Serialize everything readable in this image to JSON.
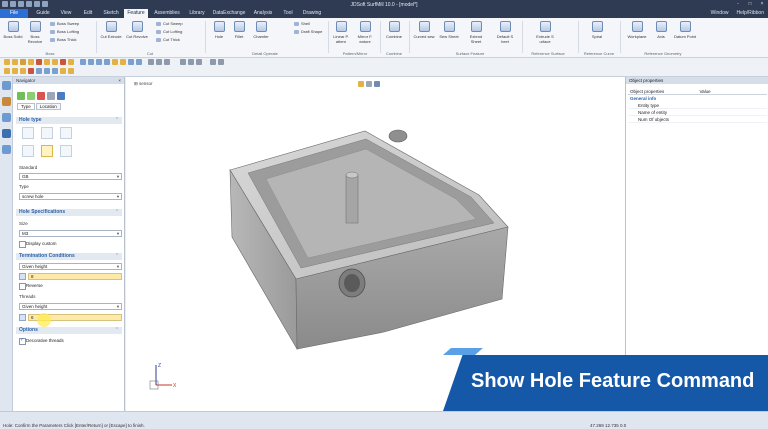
{
  "app": {
    "title": "JDSoft SurfMill 10.0 - [model*]",
    "window_controls": [
      "-",
      "□",
      "×"
    ]
  },
  "tabs": [
    "File",
    "Guide",
    "View",
    "Edit",
    "Sketch",
    "Feature",
    "Assemblies",
    "Library",
    "DataExchange",
    "Analysis",
    "Tool",
    "Drawing"
  ],
  "tabs_right": {
    "window": "Window",
    "help": "Help/Ribbon"
  },
  "ribbon": {
    "boss_solid": "Boss Solid",
    "boss_revolve": "Boss Revolve",
    "boss_sweep": "Boss Sweep",
    "boss_lofting": "Boss Lofting",
    "boss_thick": "Boss Thick",
    "boss_group": "Boss",
    "cut_extrude": "Cut Extrude",
    "cut_revolve": "Cut Revolve",
    "cut_sweep": "Cut Sweep",
    "cut_lofting": "Cut Lofting",
    "cut_thick": "Cut Thick",
    "cut_group": "Cut",
    "hole": "Hole",
    "fillet": "Fillet",
    "chamfer": "Chamfer",
    "shell": "Shell",
    "draft_shape": "Draft Shape",
    "detail_group": "Detail Operate",
    "linear_pattern": "Linear P. attern",
    "mirror_feature": "Mirror F. eature",
    "pattern_group": "Pattern/Mirror",
    "combine": "Combine",
    "combine_group": "Combine",
    "curved_sew": "Curved sew",
    "sew_sheet": "Sew Sheet",
    "extend_sheet": "Extend Sheet",
    "default_sheet": "Default S heet",
    "surface_group": "Surface Feature",
    "extrude_surface": "Extrude S urface",
    "refsurf_group": "Reference Surface",
    "spiral": "Spiral",
    "refcurve_group": "Reference Curve",
    "workplane": "Workplane",
    "axis": "Axis",
    "datum_point": "Datum Point",
    "refgeo_group": "Reference Geometry"
  },
  "navigator": {
    "title": "Navigator",
    "tabs": [
      "Type",
      "Location"
    ],
    "sections": {
      "hole_type": "Hole type",
      "hole_spec": "Hole Specifications",
      "termination": "Termination Conditions",
      "options": "Options"
    },
    "standard_label": "Standard",
    "standard_value": "GB",
    "type_label": "Type",
    "type_value": "screw hole",
    "size_label": "Size",
    "size_value": "M3",
    "display_custom": "Display custom",
    "term_value": "Given height",
    "term_depth": "8",
    "reverse": "Reverse",
    "threads_label": "Threads",
    "threads_value": "Given height",
    "threads_depth": "6",
    "decorative_threads": "Decorative threads"
  },
  "viewport": {
    "tree_label": "sensor"
  },
  "properties": {
    "title": "Object properties",
    "col1": "Object properties",
    "col2": "Value",
    "group": "General info",
    "rows": [
      "Entity type",
      "Name of entity",
      "Num Of objects"
    ]
  },
  "status": {
    "message": "Hole: Confirm the Parameters Click [Enter/Return] or [Escape] to finish.",
    "coords": "47.269  12.735  0.0"
  },
  "banner": {
    "text": "Show Hole Feature Command"
  },
  "colors": {
    "title_bar": "#2f3b52",
    "file_tab": "#2b6fd6",
    "banner": "#1658a8",
    "highlight_field": "#fde9a8",
    "section_text": "#2c62a8"
  }
}
